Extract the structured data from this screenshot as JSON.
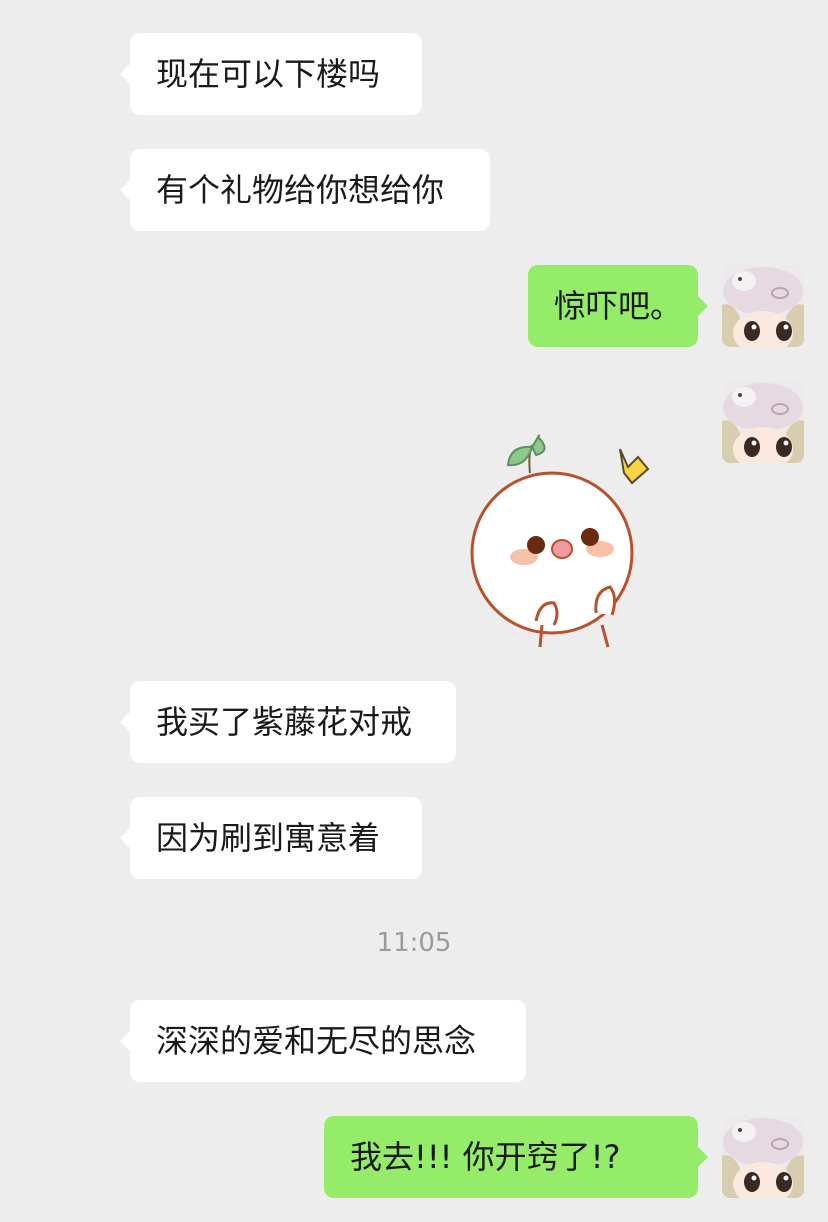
{
  "chat": {
    "messages": [
      {
        "from": "other",
        "text": "现在可以下楼吗"
      },
      {
        "from": "other",
        "text": "有个礼物给你想给你"
      },
      {
        "from": "me",
        "text": "惊吓吧。"
      },
      {
        "from": "me",
        "sticker": "cute-bun-sticker"
      },
      {
        "from": "other",
        "text": "我买了紫藤花对戒"
      },
      {
        "from": "other",
        "text": "因为刷到寓意着"
      },
      {
        "from": "other",
        "text": "深深的爱和无尽的思念"
      },
      {
        "from": "me",
        "text": "我去!!! 你开窍了!?"
      }
    ],
    "timestamp": "11:05"
  },
  "colors": {
    "background": "#ededed",
    "incoming_bubble": "#ffffff",
    "outgoing_bubble": "#95ec69",
    "timestamp_text": "#9b9b9b"
  },
  "icons": {
    "avatar": "avatar-girl-hat-icon",
    "sticker": "cute-bun-sticker"
  }
}
